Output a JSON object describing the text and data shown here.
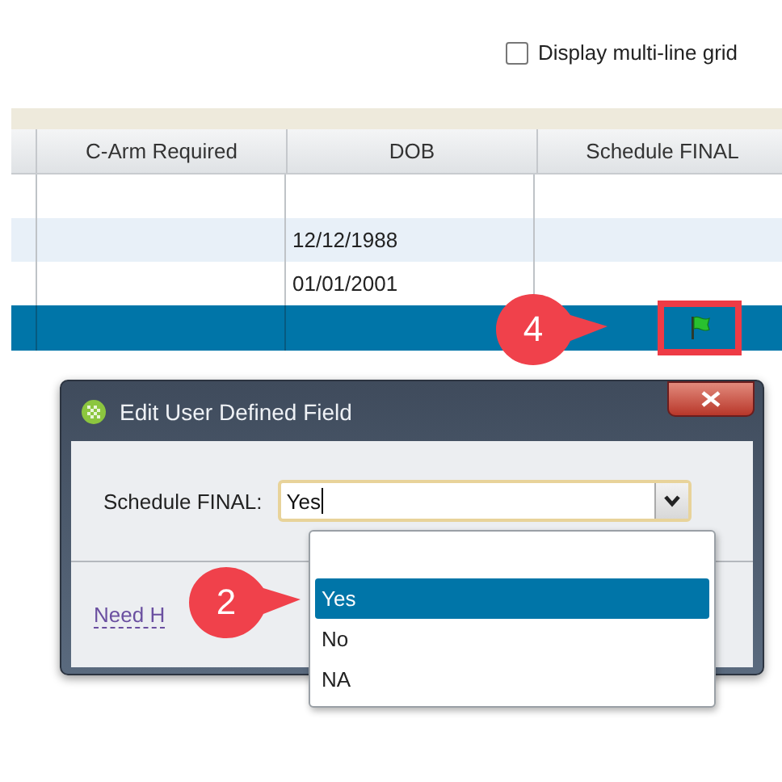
{
  "toolbar": {
    "checkbox": {
      "label": "Display multi-line grid",
      "checked": false
    }
  },
  "table": {
    "columns": [
      "C-Arm Required",
      "DOB",
      "Schedule FINAL"
    ],
    "rows": [
      {
        "dob": null,
        "flag": false,
        "selected": false
      },
      {
        "dob": "12/12/1988",
        "flag": false,
        "selected": false
      },
      {
        "dob": "01/01/2001",
        "flag": false,
        "selected": false
      },
      {
        "dob": null,
        "flag": true,
        "highlighted": true,
        "selected": true
      }
    ]
  },
  "dialog": {
    "title": "Edit User Defined Field",
    "field_label": "Schedule FINAL:",
    "value": "Yes",
    "help_link": "Need H",
    "options": [
      {
        "kind": "text",
        "label": "Yes",
        "selected": true
      },
      {
        "kind": "text",
        "label": "No",
        "selected": false
      },
      {
        "kind": "text",
        "label": "NA",
        "selected": false
      }
    ]
  },
  "callouts": [
    {
      "label": "4"
    },
    {
      "label": "2"
    }
  ]
}
